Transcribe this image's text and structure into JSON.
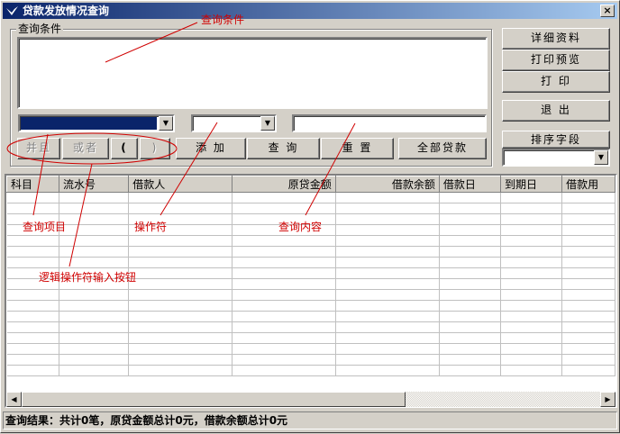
{
  "window": {
    "title": "贷款发放情况查询",
    "close_label": "×"
  },
  "query_group": {
    "label": "查询条件"
  },
  "logic_buttons": {
    "and": "并且",
    "or": "或者",
    "lparen": "(",
    "rparen": ")"
  },
  "actions": {
    "add": "添 加",
    "query": "查 询",
    "reset": "重 置",
    "all_loans": "全部贷款"
  },
  "side_buttons": {
    "detail": "详细资料",
    "print_preview": "打印预览",
    "print": "打 印",
    "exit": "退 出"
  },
  "sort": {
    "label": "排序字段"
  },
  "grid": {
    "columns": [
      "科目",
      "流水号",
      "借款人",
      "原贷金额",
      "借款余额",
      "借款日",
      "到期日",
      "借款用"
    ]
  },
  "status": {
    "text": "查询结果：共计0笔，原贷金额总计0元，借款余额总计0元"
  },
  "annotations": {
    "query_conditions": "查询条件",
    "query_item": "查询项目",
    "operator": "操作符",
    "query_content": "查询内容",
    "logic_buttons": "逻辑操作符输入按钮"
  },
  "colors": {
    "titlebar_start": "#0a246a",
    "titlebar_end": "#a6caf0",
    "annotation": "#d00000",
    "face": "#d4d0c8"
  }
}
